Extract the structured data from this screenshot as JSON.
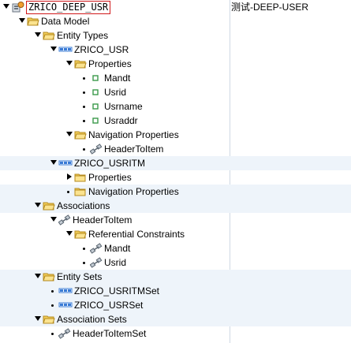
{
  "root": {
    "label": "ZRICO_DEEP_USR",
    "description": "测试-DEEP-USER"
  },
  "nodes": [
    {
      "label": "Data Model",
      "depth": 1,
      "toggle": "expanded",
      "icon": "folder-open-icon"
    },
    {
      "label": "Entity Types",
      "depth": 2,
      "toggle": "expanded",
      "icon": "folder-open-icon"
    },
    {
      "label": "ZRICO_USR",
      "depth": 3,
      "toggle": "expanded",
      "icon": "entity-type-icon"
    },
    {
      "label": "Properties",
      "depth": 4,
      "toggle": "expanded",
      "icon": "folder-open-icon"
    },
    {
      "label": "Mandt",
      "depth": 5,
      "toggle": "leaf",
      "icon": "property-icon"
    },
    {
      "label": "Usrid",
      "depth": 5,
      "toggle": "leaf",
      "icon": "property-icon"
    },
    {
      "label": "Usrname",
      "depth": 5,
      "toggle": "leaf",
      "icon": "property-icon"
    },
    {
      "label": "Usraddr",
      "depth": 5,
      "toggle": "leaf",
      "icon": "property-icon"
    },
    {
      "label": "Navigation Properties",
      "depth": 4,
      "toggle": "expanded",
      "icon": "folder-open-icon"
    },
    {
      "label": "HeaderToItem",
      "depth": 5,
      "toggle": "leaf",
      "icon": "association-icon"
    },
    {
      "label": "ZRICO_USRITM",
      "depth": 3,
      "toggle": "expanded",
      "icon": "entity-type-icon"
    },
    {
      "label": "Properties",
      "depth": 4,
      "toggle": "collapsed",
      "icon": "folder-closed-icon"
    },
    {
      "label": "Navigation Properties",
      "depth": 4,
      "toggle": "leaf",
      "icon": "folder-closed-icon"
    },
    {
      "label": "Associations",
      "depth": 2,
      "toggle": "expanded",
      "icon": "folder-open-icon"
    },
    {
      "label": "HeaderToItem",
      "depth": 3,
      "toggle": "expanded",
      "icon": "association-icon"
    },
    {
      "label": "Referential Constraints",
      "depth": 4,
      "toggle": "expanded",
      "icon": "folder-open-icon"
    },
    {
      "label": "Mandt",
      "depth": 5,
      "toggle": "leaf",
      "icon": "association-icon"
    },
    {
      "label": "Usrid",
      "depth": 5,
      "toggle": "leaf",
      "icon": "association-icon"
    },
    {
      "label": "Entity Sets",
      "depth": 2,
      "toggle": "expanded",
      "icon": "folder-open-icon"
    },
    {
      "label": "ZRICO_USRITMSet",
      "depth": 3,
      "toggle": "leaf",
      "icon": "entity-type-icon"
    },
    {
      "label": "ZRICO_USRSet",
      "depth": 3,
      "toggle": "leaf",
      "icon": "entity-type-icon"
    },
    {
      "label": "Association Sets",
      "depth": 2,
      "toggle": "expanded",
      "icon": "folder-open-icon"
    },
    {
      "label": "HeaderToItemSet",
      "depth": 3,
      "toggle": "leaf",
      "icon": "association-icon"
    }
  ],
  "colors": {
    "folder": "#f3cf5a",
    "folder_border": "#b48a1e",
    "entity": "#3a7bd5",
    "property": "#3b9a4b",
    "selection_border": "#d0191b",
    "row_alt": "#eef4fa"
  }
}
